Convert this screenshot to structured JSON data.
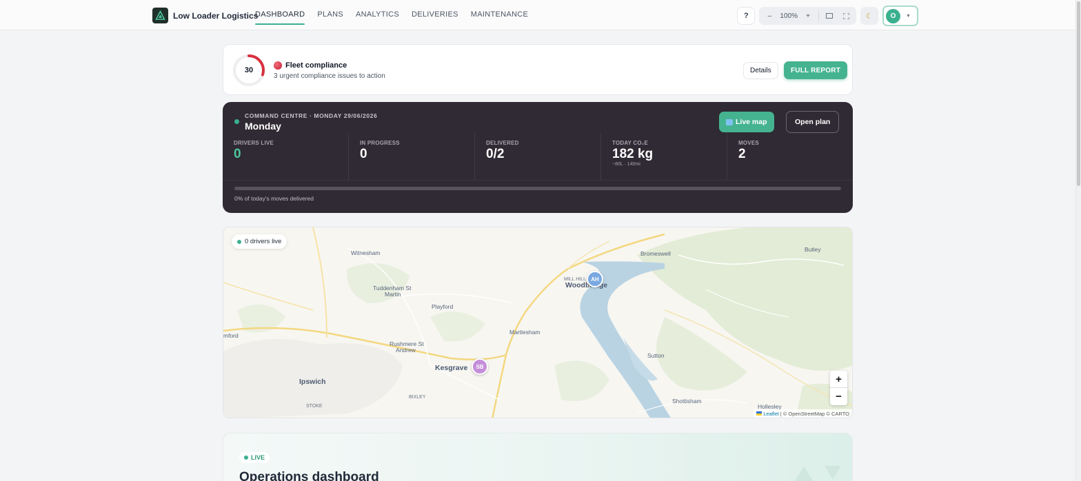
{
  "app": {
    "name": "Low Loader Logistics"
  },
  "nav": {
    "items": [
      "DASHBOARD",
      "PLANS",
      "ANALYTICS",
      "DELIVERIES",
      "MAINTENANCE"
    ],
    "active": "DASHBOARD"
  },
  "toolbar": {
    "help_label": "?",
    "zoom_out": "–",
    "zoom_level": "100%",
    "zoom_in": "+",
    "theme_icon": "moon-icon",
    "user_initial": "O"
  },
  "compliance": {
    "score": "30",
    "score_fraction": 0.3,
    "title": "Fleet compliance",
    "subtitle": "3 urgent compliance issues to action",
    "details_label": "Details",
    "report_label": "FULL REPORT",
    "status_color": "#d8313f"
  },
  "command_centre": {
    "eyebrow": "COMMAND CENTRE · MONDAY 29/06/2026",
    "title": "Monday",
    "live_map_label": "Live map",
    "open_plan_label": "Open plan",
    "stats": [
      {
        "label": "DRIVERS LIVE",
        "value": "0",
        "note": ""
      },
      {
        "label": "IN PROGRESS",
        "value": "0",
        "note": ""
      },
      {
        "label": "DELIVERED",
        "value": "0/2",
        "note": ""
      },
      {
        "label": "TODAY CO₂E",
        "value": "182 kg",
        "note": "~80L · 140mi"
      },
      {
        "label": "MOVES",
        "value": "2",
        "note": ""
      }
    ],
    "progress_fraction": 0,
    "progress_caption": "0% of today's moves delivered"
  },
  "map": {
    "drivers_live": "0 drivers live",
    "places": {
      "witnesham": "Witnesham",
      "tuddenham": "Tuddenham St",
      "martin": "Martin",
      "playford": "Playford",
      "mill_hill": "MILL HILL",
      "woodbridge": "Woodbridge",
      "bromeswell": "Bromeswell",
      "butley": "Butley",
      "martlesham": "Martlesham",
      "rushmere": "Rushmere St",
      "andrew": "Andrew",
      "kesgrave": "Kesgrave",
      "amford": "mford",
      "ipswich": "Ipswich",
      "bixley": "BIXLEY",
      "stoke": "STOKE",
      "sutton": "Sutton",
      "shottisham": "Shottisham",
      "hollesley": "Hollesley"
    },
    "markers": [
      {
        "initials": "AH",
        "color": "#7aa8e0"
      },
      {
        "initials": "SB",
        "color": "#c48ed9"
      }
    ],
    "zoom_in": "+",
    "zoom_out": "−",
    "attribution_leaflet": "Leaflet",
    "attribution_rest": "| © OpenStreetMap © CARTO"
  },
  "ops": {
    "badge": "LIVE",
    "title": "Operations dashboard"
  },
  "colors": {
    "accent": "#3bb08f",
    "dark_panel": "#2f2a33"
  }
}
